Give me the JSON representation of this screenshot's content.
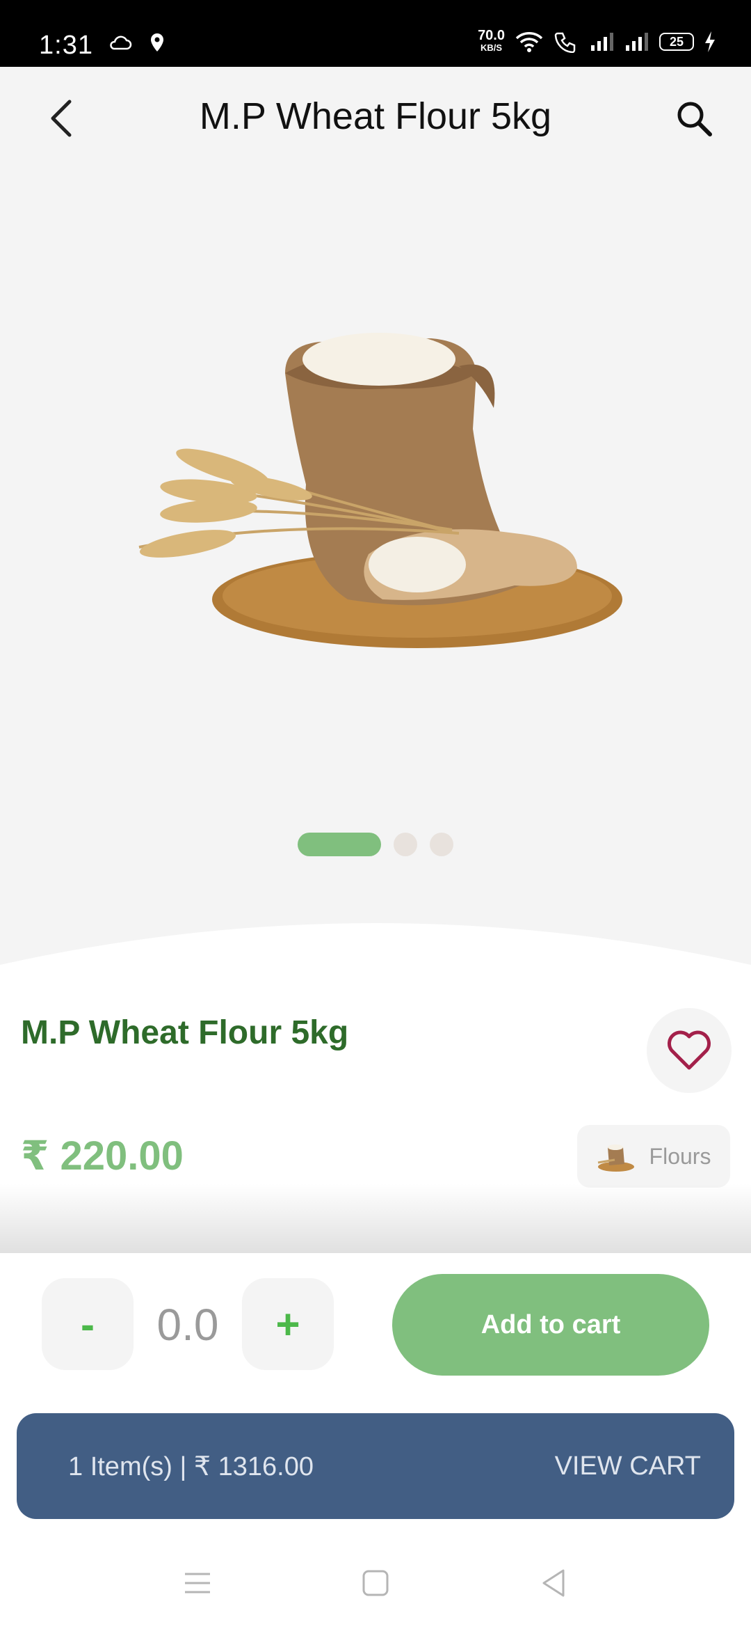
{
  "status_bar": {
    "time": "1:31",
    "speed_value": "70.0",
    "speed_unit": "KB/S",
    "battery": "25"
  },
  "header": {
    "title": "M.P Wheat Flour 5kg",
    "back_icon": "chevron-left-icon",
    "search_icon": "search-icon"
  },
  "carousel": {
    "pages": 3,
    "active_index": 0
  },
  "product": {
    "name": "M.P Wheat Flour 5kg",
    "price": "₹ 220.00",
    "category": "Flours",
    "favorite_icon": "heart-icon"
  },
  "cart_controls": {
    "minus_label": "-",
    "plus_label": "+",
    "quantity": "0.0",
    "add_to_cart_label": "Add to cart"
  },
  "cart_summary": {
    "summary": "1 Item(s) | ₹ 1316.00",
    "view_cart_label": "VIEW CART"
  },
  "colors": {
    "accent_green": "#80bf7e",
    "title_green": "#2e6b2a",
    "cart_bar_blue": "#425e84",
    "heart": "#a3204a"
  }
}
